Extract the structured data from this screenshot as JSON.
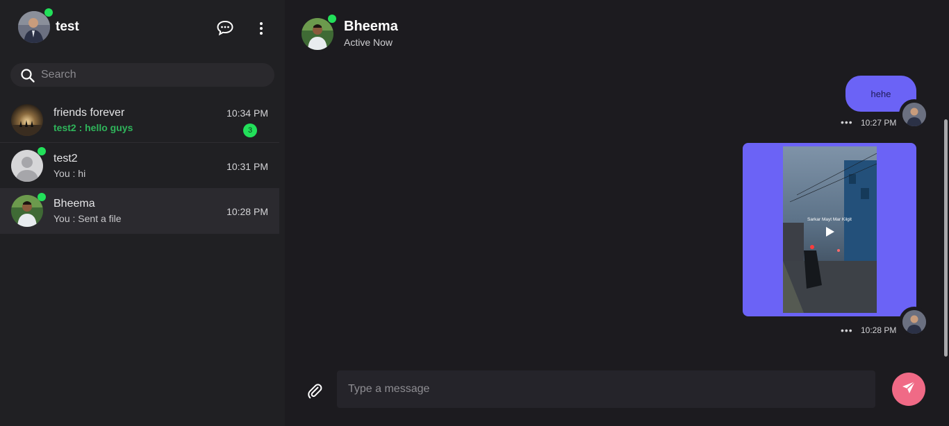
{
  "sidebar": {
    "user_name": "test",
    "search_placeholder": "Search",
    "conversations": [
      {
        "name": "friends forever",
        "preview": "test2 : hello guys",
        "time": "10:34 PM",
        "unread": "3"
      },
      {
        "name": "test2",
        "preview": "You : hi",
        "time": "10:31 PM"
      },
      {
        "name": "Bheema",
        "preview": "You : Sent a file",
        "time": "10:28 PM"
      }
    ]
  },
  "chat": {
    "peer_name": "Bheema",
    "peer_status": "Active Now",
    "messages": [
      {
        "text": "hehe",
        "time": "10:27 PM"
      },
      {
        "type": "video",
        "overlay_text": "Sarkar Mayt Mar Kilgit",
        "time": "10:28 PM"
      }
    ],
    "composer_placeholder": "Type a message"
  },
  "icons": {
    "new_chat": "chat-bubble-icon",
    "menu": "more-vertical-icon",
    "search": "search-icon",
    "attach": "paperclip-icon",
    "send": "send-icon",
    "play": "play-icon",
    "message_options": "more-horizontal-icon"
  },
  "colors": {
    "background": "#1c1b1f",
    "sidebar": "#202023",
    "accent_bubble": "#6b63f6",
    "online": "#22e05a",
    "unread_text": "#2fb55b",
    "send_button": "#f06a86"
  }
}
